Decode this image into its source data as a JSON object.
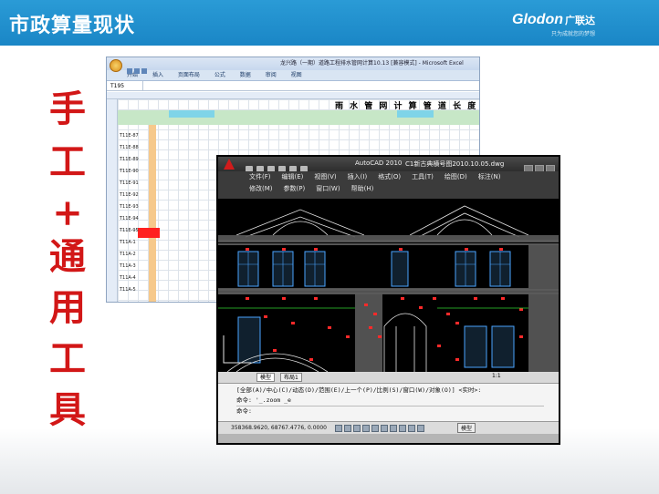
{
  "header": {
    "title": "市政算量现状",
    "logo_en": "Glodon",
    "logo_cn": "广联达",
    "logo_sub": "只为成就您的梦想"
  },
  "side_text": [
    "手",
    "工",
    "+",
    "通",
    "用",
    "工",
    "具"
  ],
  "excel": {
    "title": "龙兴路（一期）道路工程排水管网计算10.13 [兼容模式] - Microsoft Excel",
    "tabs": [
      "开始",
      "插入",
      "页面布局",
      "公式",
      "数据",
      "审阅",
      "视图"
    ],
    "name_box": "T195",
    "sheet_title": "雨 水 管 网 计 算 管 道 长 度 计 算",
    "row_ids": [
      "T11E-87",
      "T11E-88",
      "T11E-89",
      "T11E-90",
      "T11E-91",
      "T11E-92",
      "T11E-93",
      "T11E-94",
      "T11E-95",
      "T11A-1",
      "T11A-2",
      "T11A-3",
      "T11A-4",
      "T11A-5"
    ]
  },
  "autocad": {
    "app_name": "AutoCAD 2010",
    "file_name": "C1新古典横号图2010.10.05.dwg",
    "menu_row1": [
      "文件(F)",
      "编辑(E)",
      "视图(V)",
      "插入(I)",
      "格式(O)",
      "工具(T)",
      "绘图(D)",
      "标注(N)"
    ],
    "menu_row2": [
      "修改(M)",
      "参数(P)",
      "窗口(W)",
      "帮助(H)"
    ],
    "tabs": [
      "模型",
      "布局1"
    ],
    "command_lines": [
      "[全部(A)/中心(C)/动态(D)/范围(E)/上一个(P)/比例(S)/窗口(W)/对象(O)] <实时>:",
      "命令: '_.zoom _e",
      "命令:"
    ],
    "coordinates": "358368.9620, 68767.4776, 0.0000",
    "model_label": "模型",
    "scale": "1:1"
  },
  "colors": {
    "header_blue": "#1a86c6",
    "side_red": "#d21717",
    "cad_red": "#ff2a2a"
  }
}
